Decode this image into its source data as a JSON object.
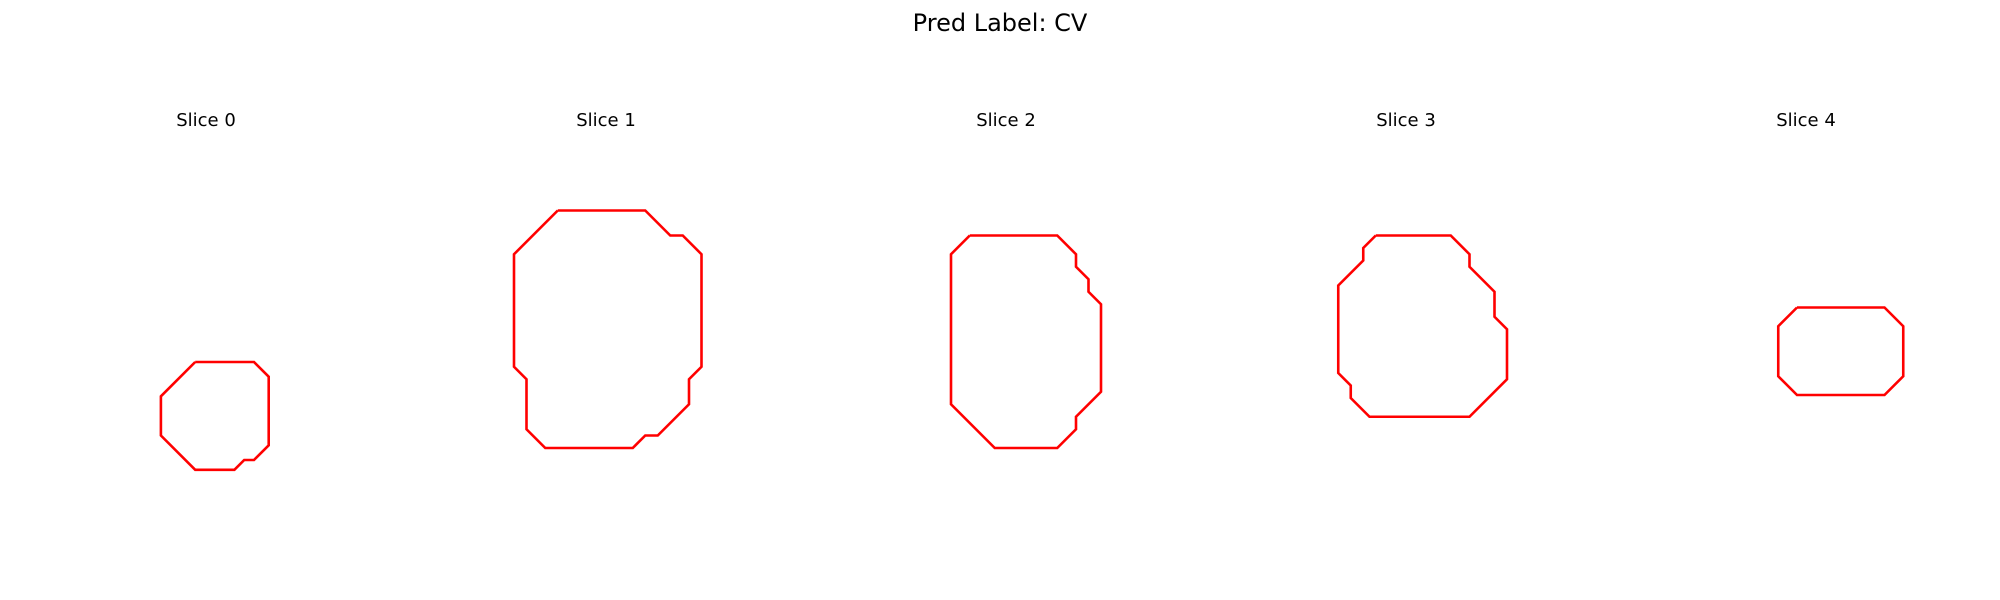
{
  "title": "Pred Label: CV",
  "outline_color": "#ff0000",
  "slices": [
    {
      "label": "Slice 0",
      "points": [
        [
          4,
          5
        ],
        [
          10,
          5
        ],
        [
          11.5,
          6.5
        ],
        [
          11.5,
          13.5
        ],
        [
          10,
          15
        ],
        [
          9,
          15
        ],
        [
          8,
          16
        ],
        [
          4,
          16
        ],
        [
          0.5,
          12.5
        ],
        [
          0.5,
          8.5
        ]
      ]
    },
    {
      "label": "Slice 1",
      "points": [
        [
          3.5,
          1
        ],
        [
          10.5,
          1
        ],
        [
          12.5,
          3
        ],
        [
          13.5,
          3
        ],
        [
          15,
          4.5
        ],
        [
          15,
          13.5
        ],
        [
          14,
          14.5
        ],
        [
          14,
          16.5
        ],
        [
          11.5,
          19
        ],
        [
          10.5,
          19
        ],
        [
          9.5,
          20
        ],
        [
          2.5,
          20
        ],
        [
          1,
          18.5
        ],
        [
          1,
          14.5
        ],
        [
          0,
          13.5
        ],
        [
          0,
          4.5
        ]
      ]
    },
    {
      "label": "Slice 2",
      "points": [
        [
          1.5,
          3
        ],
        [
          8.5,
          3
        ],
        [
          10,
          4.5
        ],
        [
          10,
          5.5
        ],
        [
          11,
          6.5
        ],
        [
          11,
          7.5
        ],
        [
          12,
          8.5
        ],
        [
          12,
          15.5
        ],
        [
          10,
          17.5
        ],
        [
          10,
          18.5
        ],
        [
          8.5,
          20
        ],
        [
          3.5,
          20
        ],
        [
          0,
          16.5
        ],
        [
          0,
          4.5
        ]
      ]
    },
    {
      "label": "Slice 3",
      "points": [
        [
          3.5,
          3
        ],
        [
          9.5,
          3
        ],
        [
          11,
          4.5
        ],
        [
          11,
          5.5
        ],
        [
          13,
          7.5
        ],
        [
          13,
          9.5
        ],
        [
          14,
          10.5
        ],
        [
          14,
          14.5
        ],
        [
          11,
          17.5
        ],
        [
          3,
          17.5
        ],
        [
          1.5,
          16
        ],
        [
          1.5,
          15
        ],
        [
          0.5,
          14
        ],
        [
          0.5,
          7
        ],
        [
          2.5,
          5
        ],
        [
          2.5,
          4
        ]
      ]
    },
    {
      "label": "Slice 4",
      "points": [
        [
          2,
          1
        ],
        [
          9,
          1
        ],
        [
          10.5,
          2.5
        ],
        [
          10.5,
          6.5
        ],
        [
          9,
          8
        ],
        [
          2,
          8
        ],
        [
          0.5,
          6.5
        ],
        [
          0.5,
          2.5
        ]
      ]
    }
  ]
}
